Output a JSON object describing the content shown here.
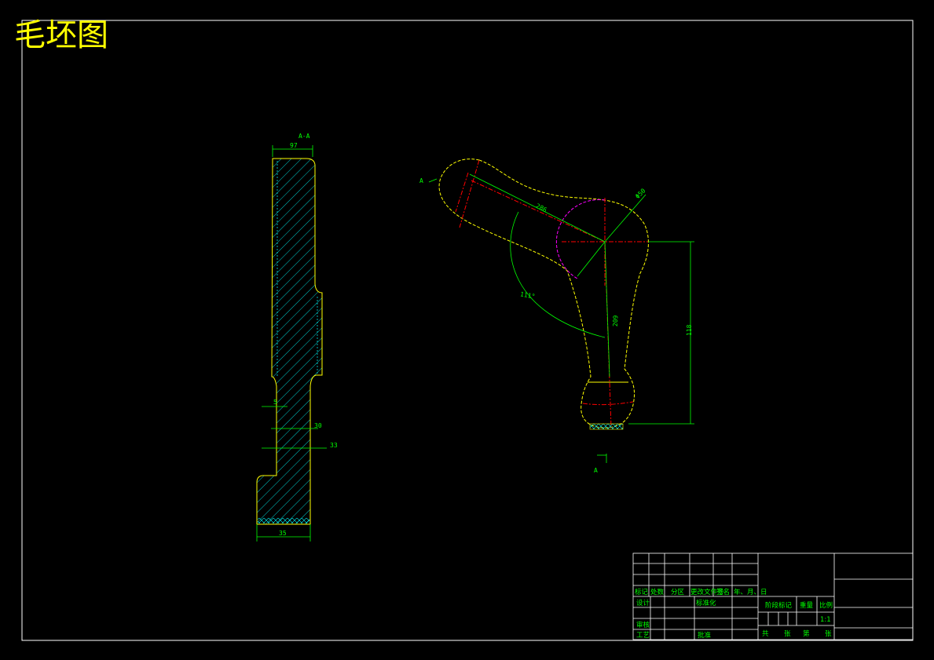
{
  "title": "毛坯图",
  "colors": {
    "background": "#000000",
    "frame": "#ffffff",
    "outline": "#ffff00",
    "dimension": "#00ff00",
    "hatch": "#00ffff",
    "center": "#ff0000",
    "circle": "#ff00ff"
  },
  "section_view": {
    "label": "A-A",
    "dims": {
      "top_width": "97",
      "small_step": "5",
      "mid": "30",
      "right": "33",
      "bottom_width": "35"
    }
  },
  "main_view": {
    "section_mark": "A",
    "dims": {
      "diameter": "Φ50",
      "long_arm": "286",
      "angle": "111°",
      "short_arm": "209",
      "height": "118"
    }
  },
  "title_block": {
    "headers": [
      "标记",
      "处数",
      "分区",
      "更改文件号",
      "签名",
      "年、月、日"
    ],
    "row_design": [
      "设计",
      "标准化"
    ],
    "row_review": [
      "审核"
    ],
    "row_process": [
      "工艺",
      "批准"
    ],
    "stage_label": "阶段标记",
    "weight_label": "重量",
    "scale_label": "比例",
    "scale_value": "1:1",
    "sheets": [
      "共",
      "张",
      "第",
      "张"
    ]
  }
}
